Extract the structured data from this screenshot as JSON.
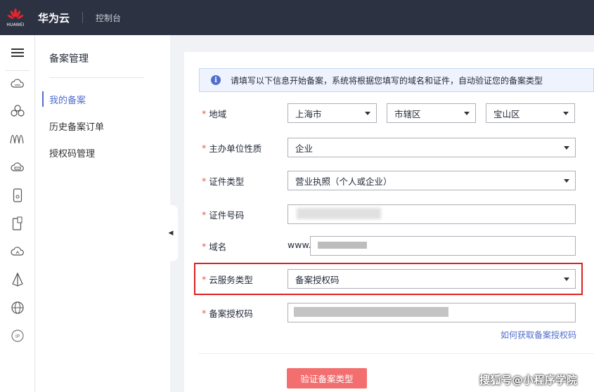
{
  "topbar": {
    "logo_text": "HUAWEI",
    "brand": "华为云",
    "console": "控制台",
    "bg_color": "#2d3243",
    "logo_color": "#e3262f"
  },
  "rail": {
    "icons": [
      "menu-icon",
      "cloud-icon",
      "cluster-icon",
      "wave-icon",
      "storage-icon",
      "phone-icon",
      "device-icon",
      "cloud-upload-icon",
      "sail-icon",
      "globe-icon",
      "ip-icon"
    ]
  },
  "nav": {
    "title": "备案管理",
    "items": [
      {
        "label": "我的备案",
        "active": true
      },
      {
        "label": "历史备案订单",
        "active": false
      },
      {
        "label": "授权码管理",
        "active": false
      }
    ]
  },
  "info": {
    "icon": "i",
    "text": "请填写以下信息开始备案，系统将根据您填写的域名和证件，自动验证您的备案类型"
  },
  "form": {
    "region": {
      "label": "地域",
      "province": "上海市",
      "city": "市辖区",
      "district": "宝山区"
    },
    "unit_type": {
      "label": "主办单位性质",
      "value": "企业"
    },
    "cert_type": {
      "label": "证件类型",
      "value": "营业执照（个人或企业）"
    },
    "cert_no": {
      "label": "证件号码"
    },
    "domain": {
      "label": "域名",
      "prefix": "www."
    },
    "service_type": {
      "label": "云服务类型",
      "value": "备案授权码"
    },
    "auth_code": {
      "label": "备案授权码"
    },
    "help_link": "如何获取备案授权码",
    "required_mark": "*"
  },
  "actions": {
    "verify": "验证备案类型"
  },
  "watermark": "搜狐号@小程序学院",
  "colors": {
    "accent": "#526ecc",
    "button": "#f36f6f",
    "highlight": "#e02020",
    "required": "#e5554c"
  }
}
